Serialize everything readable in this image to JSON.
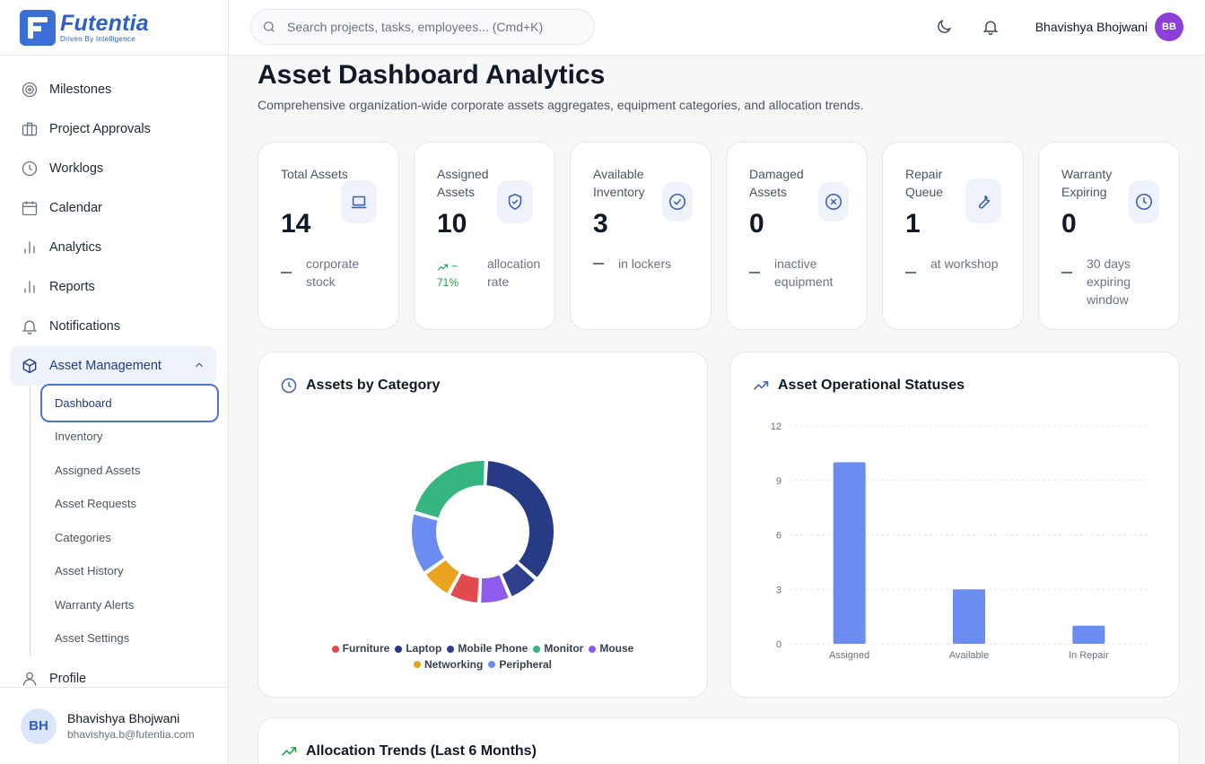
{
  "app": {
    "name": "Futentia",
    "tagline": "Driven By Intelligence"
  },
  "search": {
    "placeholder": "Search projects, tasks, employees... (Cmd+K)"
  },
  "user": {
    "name": "Bhavishya Bhojwani",
    "initials": "BB",
    "email": "bhavishya.b@futentia.com",
    "initials_alt": "BH"
  },
  "sidebar": {
    "items": [
      {
        "label": "Milestones",
        "icon": "target-icon"
      },
      {
        "label": "Project Approvals",
        "icon": "briefcase-icon"
      },
      {
        "label": "Worklogs",
        "icon": "clock-icon"
      },
      {
        "label": "Calendar",
        "icon": "calendar-icon"
      },
      {
        "label": "Analytics",
        "icon": "bar-chart-icon"
      },
      {
        "label": "Reports",
        "icon": "bar-chart-icon"
      },
      {
        "label": "Notifications",
        "icon": "bell-icon"
      },
      {
        "label": "Asset Management",
        "icon": "box-icon"
      }
    ],
    "sub_items": [
      "Dashboard",
      "Inventory",
      "Assigned Assets",
      "Asset Requests",
      "Categories",
      "Asset History",
      "Warranty Alerts",
      "Asset Settings"
    ],
    "profile_label": "Profile"
  },
  "page": {
    "title": "Asset Dashboard Analytics",
    "subtitle": "Comprehensive organization-wide corporate assets aggregates, equipment categories, and allocation trends."
  },
  "stats": [
    {
      "label": "Total Assets",
      "value": "14",
      "foot": "corporate stock",
      "icon": "laptop-icon"
    },
    {
      "label": "Assigned Assets",
      "value": "10",
      "trend": "~ 71%",
      "foot": "allocation rate",
      "icon": "shield-check-icon"
    },
    {
      "label": "Available Inventory",
      "value": "3",
      "foot": "in lockers",
      "icon": "check-circle-icon"
    },
    {
      "label": "Damaged Assets",
      "value": "0",
      "foot": "inactive equipment",
      "icon": "x-circle-icon"
    },
    {
      "label": "Repair Queue",
      "value": "1",
      "foot": "at workshop",
      "icon": "wrench-icon"
    },
    {
      "label": "Warranty Expiring",
      "value": "0",
      "foot": "30 days expiring window",
      "icon": "clock-icon"
    }
  ],
  "panels": {
    "category_title": "Assets by Category",
    "status_title": "Asset Operational Statuses",
    "trend_title": "Allocation Trends (Last 6 Months)"
  },
  "colors": {
    "Furniture": "#e14a4f",
    "Laptop": "#263a85",
    "Mobile Phone": "#2e3f8c",
    "Monitor": "#35b57f",
    "Mouse": "#8e5bea",
    "Networking": "#e9a31f",
    "Peripheral": "#6b8cf0",
    "bar": "#6b8cf0"
  },
  "chart_data": [
    {
      "type": "pie",
      "title": "Assets by Category",
      "categories": [
        "Laptop",
        "Mobile Phone",
        "Mouse",
        "Furniture",
        "Networking",
        "Peripheral",
        "Monitor"
      ],
      "values": [
        5,
        1,
        1,
        1,
        1,
        2,
        3
      ],
      "legend": [
        "Furniture",
        "Laptop",
        "Mobile Phone",
        "Monitor",
        "Mouse",
        "Networking",
        "Peripheral"
      ]
    },
    {
      "type": "bar",
      "title": "Asset Operational Statuses",
      "categories": [
        "Assigned",
        "Available",
        "In Repair"
      ],
      "values": [
        10,
        3,
        1
      ],
      "ylim": [
        0,
        12
      ],
      "yticks": [
        0,
        3,
        6,
        9,
        12
      ],
      "grid": true
    }
  ]
}
